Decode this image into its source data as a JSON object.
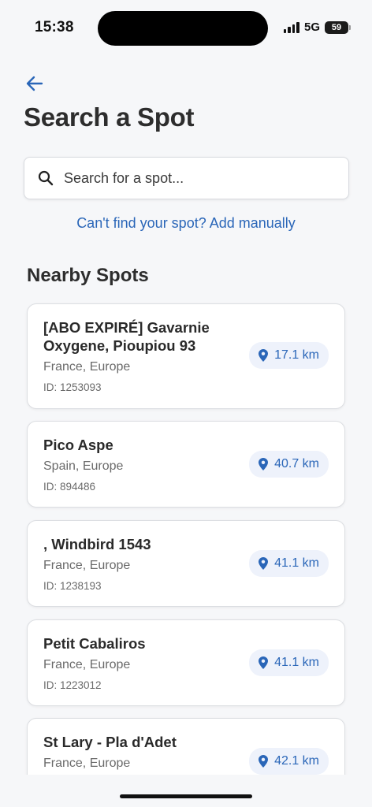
{
  "status_bar": {
    "time": "15:38",
    "network": "5G",
    "battery": "59"
  },
  "header": {
    "back_icon": "arrow-left-icon",
    "title": "Search a Spot"
  },
  "search": {
    "placeholder": "Search for a spot...",
    "value": "",
    "icon": "search-icon"
  },
  "add_manually_link": "Can't find your spot? Add manually",
  "nearby": {
    "title": "Nearby Spots",
    "spots": [
      {
        "name": "[ABO EXPIRÉ] Gavarnie Oxygene, Pioupiou 93",
        "location": "France, Europe",
        "id": "ID: 1253093",
        "distance": "17.1 km"
      },
      {
        "name": "Pico Aspe",
        "location": "Spain, Europe",
        "id": "ID: 894486",
        "distance": "40.7 km"
      },
      {
        "name": ", Windbird 1543",
        "location": "France, Europe",
        "id": "ID: 1238193",
        "distance": "41.1 km"
      },
      {
        "name": "Petit Cabaliros",
        "location": "France, Europe",
        "id": "ID: 1223012",
        "distance": "41.1 km"
      },
      {
        "name": "St Lary - Pla d'Adet",
        "location": "France, Europe",
        "id": "",
        "distance": "42.1 km"
      }
    ]
  },
  "colors": {
    "accent": "#2a66b8",
    "badge_bg": "#eef2fb",
    "background": "#f6f7f9"
  }
}
